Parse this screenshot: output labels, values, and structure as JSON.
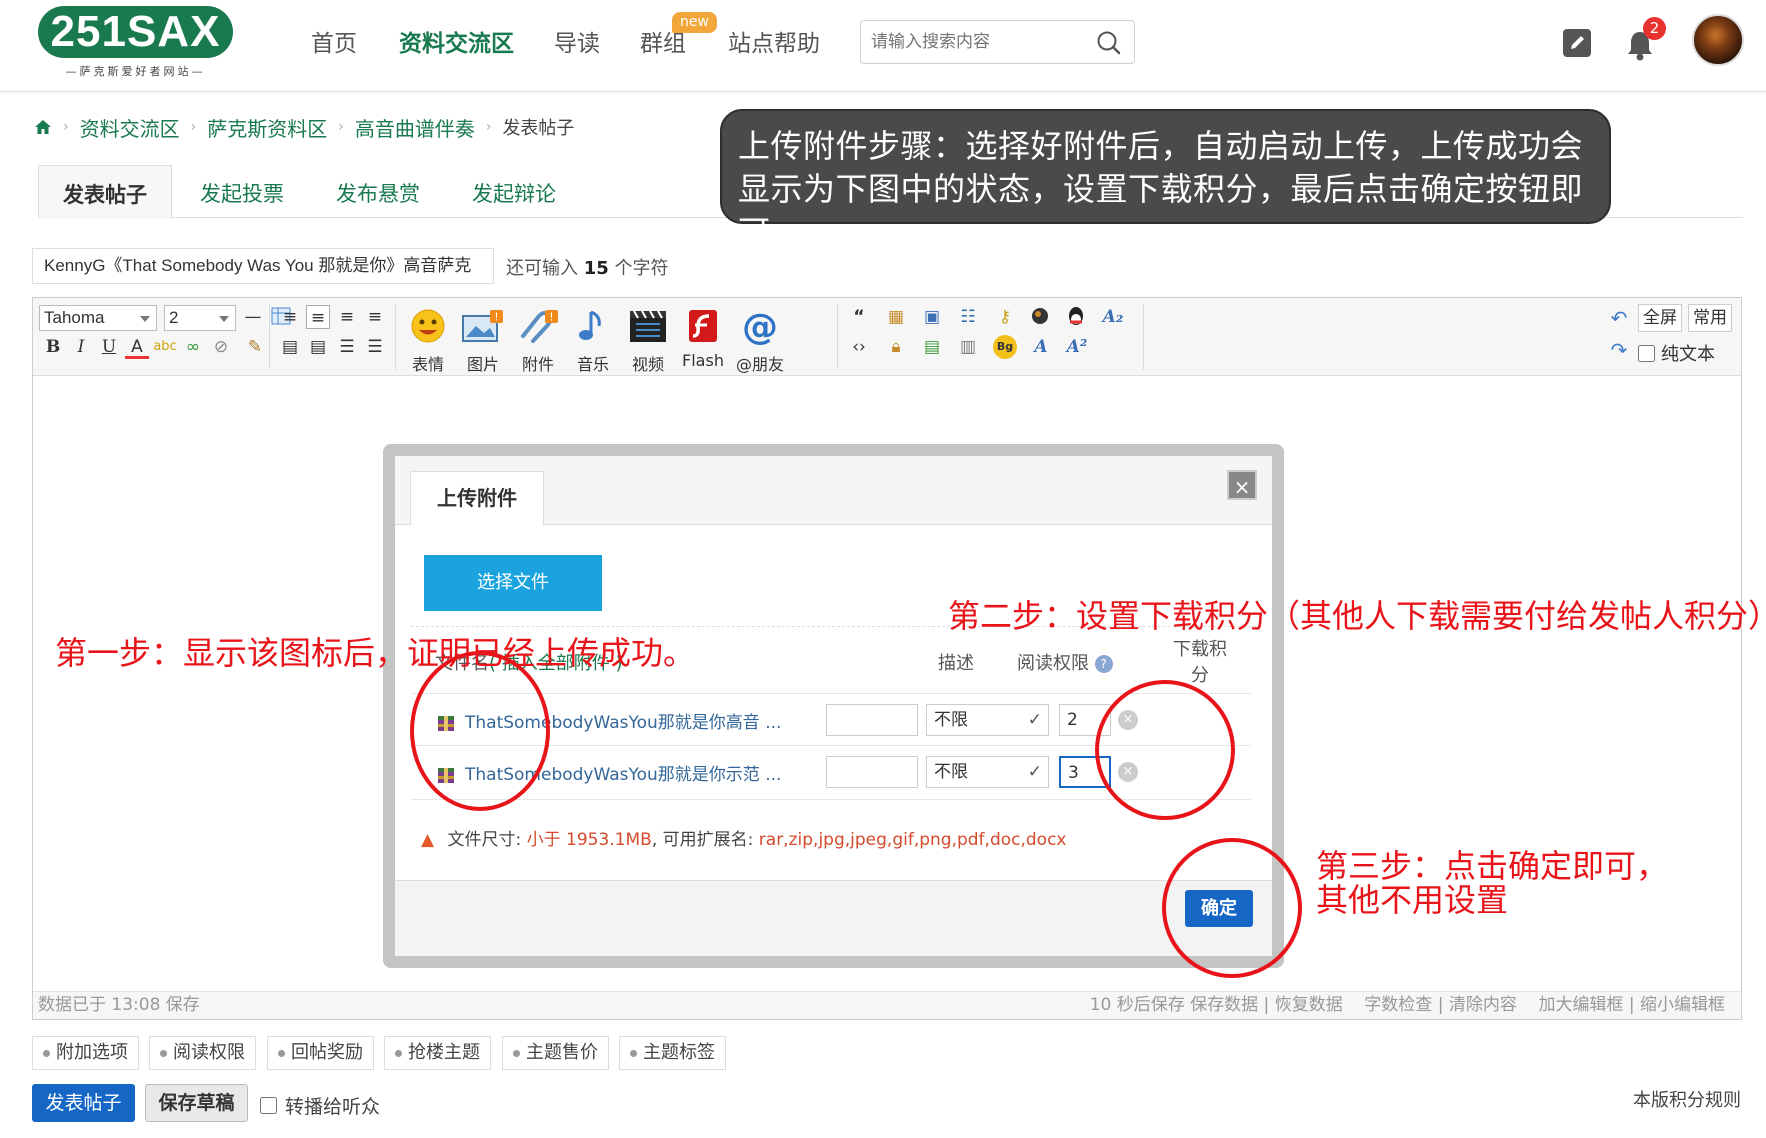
{
  "header": {
    "logo_text": "251SAX",
    "logo_sub": "—萨克斯爱好者网站—",
    "nav": [
      "首页",
      "资料交流区",
      "导读",
      "群组",
      "站点帮助"
    ],
    "nav_active": "资料交流区",
    "new_badge": "new",
    "search_placeholder": "请输入搜索内容",
    "notification_count": "2"
  },
  "breadcrumb": {
    "items": [
      "资料交流区",
      "萨克斯资料区",
      "高音曲谱伴奏"
    ],
    "current": "发表帖子"
  },
  "tabs": [
    "发表帖子",
    "发起投票",
    "发布悬赏",
    "发起辩论"
  ],
  "callout": "上传附件步骤：选择好附件后，自动启动上传，上传成功会显示为下图中的状态，设置下载积分，最后点击确定按钮即可。",
  "title_input": "KennyG《That Somebody Was You 那就是你》高音萨克",
  "remain": {
    "prefix": "还可输入",
    "count": "15",
    "suffix": "个字符"
  },
  "toolbar": {
    "font": "Tahoma",
    "size": "2",
    "buttons": [
      "表情",
      "图片",
      "附件",
      "音乐",
      "视频",
      "Flash",
      "@朋友"
    ],
    "fullscreen": "全屏",
    "common": "常用",
    "plaintext": "纯文本"
  },
  "statusbar": {
    "left": "数据已于 13:08 保存",
    "right": "10 秒后保存 保存数据 | 恢复数据    字数检查 | 清除内容    加大编辑框 | 缩小编辑框"
  },
  "dialog": {
    "tab": "上传附件",
    "choose_file": "选择文件",
    "col_name": "文件名",
    "col_insert": "( 插入全部附件 )",
    "col_desc": "描述",
    "col_perm": "阅读权限",
    "col_points_1": "下载积",
    "col_points_2": "分",
    "files": [
      {
        "name": "ThatSomebodyWasYou那就是你高音 ...",
        "perm": "不限",
        "points": "2"
      },
      {
        "name": "ThatSomebodyWasYou那就是你示范 ...",
        "perm": "不限",
        "points": "3"
      }
    ],
    "limit_label": "文件尺寸:",
    "limit_size": "小于 1953.1MB",
    "limit_ext_label": ", 可用扩展名:",
    "limit_ext": "rar,zip,jpg,jpeg,gif,png,pdf,doc,docx",
    "ok": "确定"
  },
  "annotations": {
    "step1": "第一步：显示该图标后，证明已经上传成功。",
    "step2": "第二步：设置下载积分（其他人下载需要付给发帖人积分）",
    "step3_line1": "第三步：点击确定即可，",
    "step3_line2": "其他不用设置"
  },
  "options": [
    "附加选项",
    "阅读权限",
    "回帖奖励",
    "抢楼主题",
    "主题售价",
    "主题标签"
  ],
  "actions": {
    "post": "发表帖子",
    "draft": "保存草稿",
    "relay": "转播给听众",
    "rules": "本版积分规则"
  },
  "colors": {
    "brand": "#1a7a4f",
    "primary": "#1666c6",
    "annotation": "#e8141a",
    "upload": "#1aa3df"
  }
}
